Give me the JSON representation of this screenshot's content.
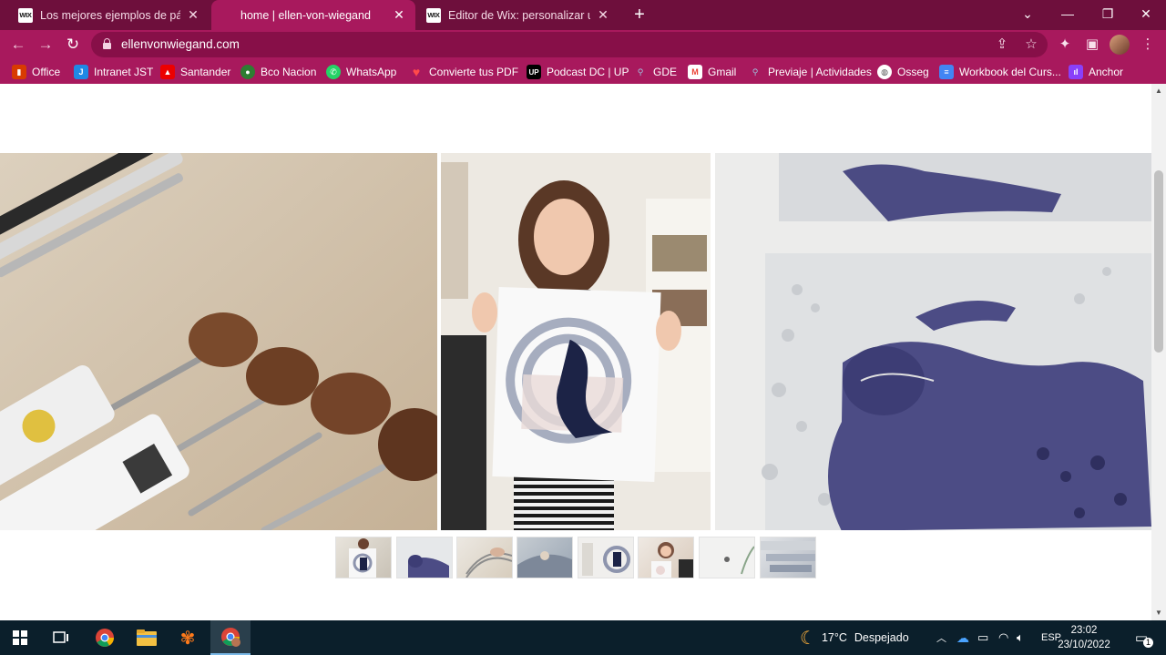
{
  "browser": {
    "tabs": [
      {
        "favicon": "WIX",
        "title": "Los mejores ejemplos de páginas",
        "active": false
      },
      {
        "favicon": "",
        "title": "home | ellen-von-wiegand",
        "active": true
      },
      {
        "favicon": "WIX",
        "title": "Editor de Wix: personalizar una w",
        "active": false
      }
    ],
    "url": "ellenvonwiegand.com",
    "bookmarks": [
      {
        "label": "Office",
        "icon": "office-icon",
        "color": "#d83b01"
      },
      {
        "label": "Intranet JST",
        "icon": "intranet-icon",
        "color": "#1e88e5"
      },
      {
        "label": "Santander",
        "icon": "santander-icon",
        "color": "#ec0000"
      },
      {
        "label": "Bco Nacion",
        "icon": "bco-nacion-icon",
        "color": "#2e7d32"
      },
      {
        "label": "WhatsApp",
        "icon": "whatsapp-icon",
        "color": "#25d366"
      },
      {
        "label": "Convierte tus PDF",
        "icon": "pdf-heart-icon",
        "color": "#e53935"
      },
      {
        "label": "Podcast DC | UP",
        "icon": "up-icon",
        "color": "#000000"
      },
      {
        "label": "GDE",
        "icon": "gde-icon",
        "color": "#5c8fb8"
      },
      {
        "label": "Gmail",
        "icon": "gmail-icon",
        "color": "#ea4335"
      },
      {
        "label": "Previaje | Actividades",
        "icon": "previaje-icon",
        "color": "#5c8fb8"
      },
      {
        "label": "Osseg",
        "icon": "globe-icon",
        "color": "#ffffff"
      },
      {
        "label": "Workbook del Curs...",
        "icon": "docs-icon",
        "color": "#4285f4"
      },
      {
        "label": "Anchor",
        "icon": "anchor-icon",
        "color": "#8940fa"
      }
    ]
  },
  "page": {
    "thumbnails": 8
  },
  "taskbar": {
    "weather_temp": "17°C",
    "weather_text": "Despejado",
    "language": "ESP",
    "time": "23:02",
    "date": "23/10/2022",
    "notification_count": "1"
  }
}
